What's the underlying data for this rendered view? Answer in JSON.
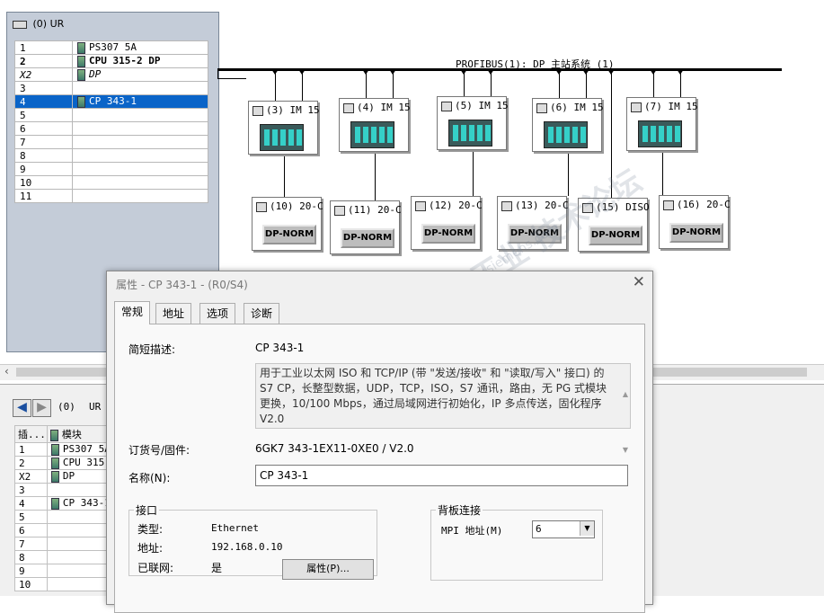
{
  "rack": {
    "title": "(0) UR",
    "rows": [
      {
        "slot": "1",
        "module": "PS307 5A",
        "bold": false
      },
      {
        "slot": "2",
        "module": "CPU 315-2 DP",
        "bold": true
      },
      {
        "slot": "X2",
        "module": "DP",
        "bold": false,
        "italic": true
      },
      {
        "slot": "3",
        "module": ""
      },
      {
        "slot": "4",
        "module": "CP 343-1",
        "selected": true
      },
      {
        "slot": "5",
        "module": ""
      },
      {
        "slot": "6",
        "module": ""
      },
      {
        "slot": "7",
        "module": ""
      },
      {
        "slot": "8",
        "module": ""
      },
      {
        "slot": "9",
        "module": ""
      },
      {
        "slot": "10",
        "module": ""
      },
      {
        "slot": "11",
        "module": ""
      }
    ]
  },
  "network": {
    "bus_label": "PROFIBUS(1): DP 主站系统 (1)",
    "im_nodes": [
      "(3) IM 15",
      "(4) IM 15",
      "(5) IM 15",
      "(6) IM 15",
      "(7) IM 15"
    ],
    "dp_nodes": [
      {
        "label": "(10) 20-C",
        "button": "DP-NORM"
      },
      {
        "label": "(11) 20-C",
        "button": "DP-NORM"
      },
      {
        "label": "(12) 20-C",
        "button": "DP-NORM"
      },
      {
        "label": "(13) 20-C",
        "button": "DP-NORM"
      },
      {
        "label": "(15) DISO",
        "button": "DP-NORM"
      },
      {
        "label": "(16) 20-C",
        "button": "DP-NORM"
      }
    ]
  },
  "lower": {
    "rack_label": "(0)",
    "rack_name": "UR",
    "col_slot": "插...",
    "col_module": "模块",
    "rows": [
      {
        "slot": "1",
        "module": "PS307 5A"
      },
      {
        "slot": "2",
        "module": "CPU 315-"
      },
      {
        "slot": "X2",
        "module": "DP"
      },
      {
        "slot": "3",
        "module": ""
      },
      {
        "slot": "4",
        "module": "CP 343-1"
      },
      {
        "slot": "5",
        "module": ""
      },
      {
        "slot": "6",
        "module": ""
      },
      {
        "slot": "7",
        "module": ""
      },
      {
        "slot": "8",
        "module": ""
      },
      {
        "slot": "9",
        "module": ""
      },
      {
        "slot": "10",
        "module": ""
      }
    ]
  },
  "dialog": {
    "title": "属性 - CP 343-1 - (R0/S4)",
    "tabs": [
      "常规",
      "地址",
      "选项",
      "诊断"
    ],
    "short_desc_label": "简短描述:",
    "short_desc_value": "CP 343-1",
    "description": "用于工业以太网 ISO 和 TCP/IP (带 \"发送/接收\" 和 \"读取/写入\" 接口) 的 S7 CP，长整型数据，UDP，TCP，ISO，S7 通讯，路由，无 PG 式模块更换，10/100 Mbps，通过局域网进行初始化，IP 多点传送，固化程序 V2.0",
    "order_label": "订货号/固件:",
    "order_value": "6GK7 343-1EX11-0XE0 / V2.0",
    "name_label": "名称(N):",
    "name_value": "CP 343-1",
    "interface": {
      "legend": "接口",
      "type_label": "类型:",
      "type_value": "Ethernet",
      "addr_label": "地址:",
      "addr_value": "192.168.0.10",
      "net_label": "已联网:",
      "net_value": "是",
      "props_button": "属性(P)..."
    },
    "backplane": {
      "legend": "背板连接",
      "mpi_label": "MPI 地址(M)",
      "mpi_value": "6"
    }
  },
  "watermark": {
    "text": "西门子工业  技术论坛",
    "url": "www.ad.industry.siemens.com"
  }
}
